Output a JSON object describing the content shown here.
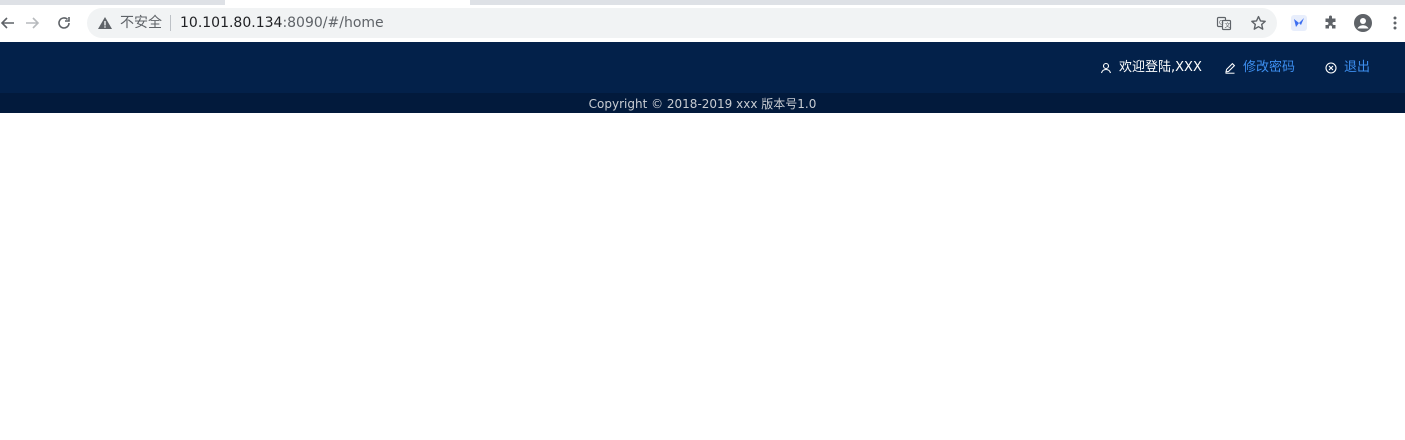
{
  "browser": {
    "security_label": "不安全",
    "url_host": "10.101.80.134",
    "url_rest": ":8090/#/home",
    "icons": {
      "back": "back-arrow-icon",
      "forward": "forward-arrow-icon",
      "reload": "reload-icon",
      "warning": "warning-icon",
      "translate": "translate-icon",
      "bookmark": "star-icon",
      "extension_a": "extension-app-icon",
      "extensions": "puzzle-icon",
      "profile": "profile-icon",
      "menu": "kebab-menu-icon"
    }
  },
  "header": {
    "welcome_text": "欢迎登陆,XXX",
    "change_password": "修改密码",
    "logout": "退出"
  },
  "footer": {
    "copyright": "Copyright © 2018-2019 xxx 版本号1.0"
  },
  "colors": {
    "header_bg": "#03214a",
    "footer_bg": "#021a3c",
    "link": "#3d8ff0"
  }
}
